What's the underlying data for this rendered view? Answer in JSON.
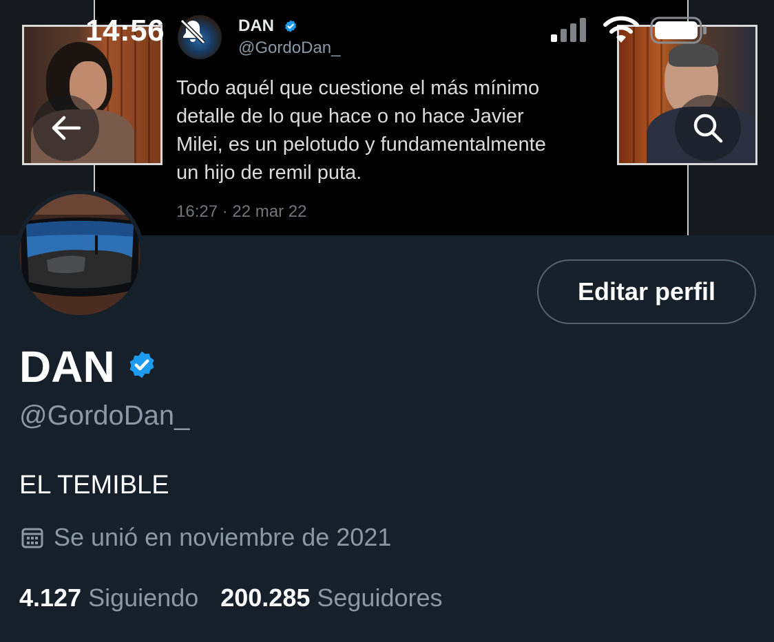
{
  "status_bar": {
    "time": "14:56"
  },
  "banner_tweet": {
    "name": "DAN",
    "handle": "@GordoDan_",
    "text_lines": [
      "Todo aquél que cuestione el más mínimo",
      "detalle de lo que hace o no hace Javier",
      "Milei, es un pelotudo y fundamentalmente",
      "un hijo de remil puta."
    ],
    "timestamp": "16:27 · 22 mar 22"
  },
  "header": {
    "back_icon": "arrow-left-icon",
    "search_icon": "search-icon"
  },
  "profile": {
    "edit_button_label": "Editar perfil",
    "display_name": "DAN",
    "verified_icon": "verified-badge-icon",
    "handle": "@GordoDan_",
    "bio": "EL TEMIBLE",
    "joined_icon": "calendar-icon",
    "joined": "Se unió en noviembre de 2021",
    "following_count": "4.127",
    "following_label": "Siguiendo",
    "followers_count": "200.285",
    "followers_label": "Seguidores"
  },
  "colors": {
    "background": "#15202b",
    "verified": "#1d9bf0",
    "secondary_text": "#8b98a5",
    "button_border": "#536471"
  }
}
